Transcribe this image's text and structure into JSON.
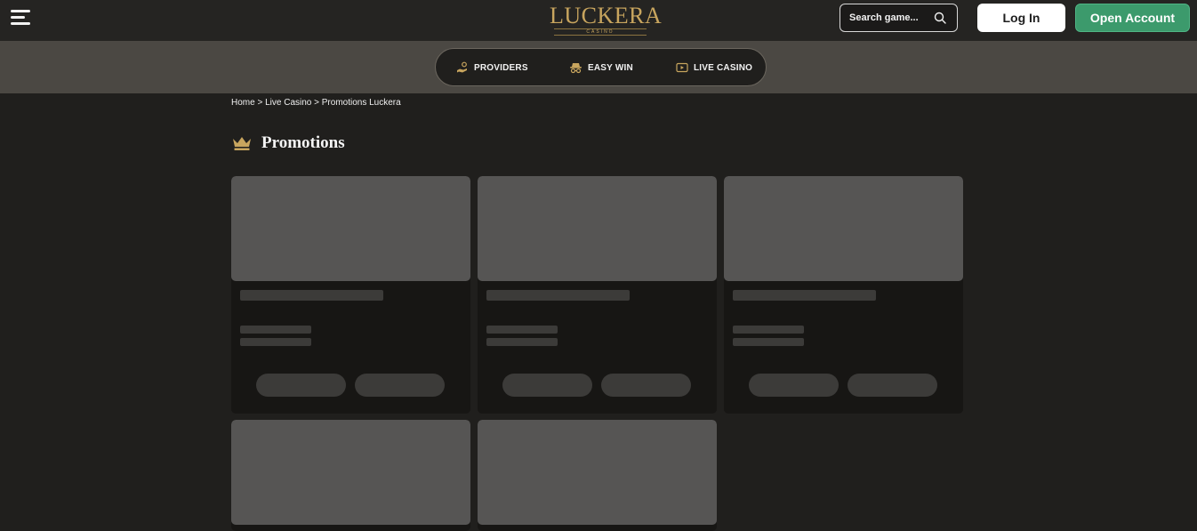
{
  "header": {
    "menu_icon": "hamburger-icon",
    "logo_text": "LUCKERA",
    "logo_subtext": "CASINO",
    "search_placeholder": "Search game...",
    "search_icon": "search-icon",
    "login_label": "Log In",
    "open_account_label": "Open Account"
  },
  "subnav": {
    "items": [
      {
        "label": "PROVIDERS",
        "icon": "hand-coins-icon"
      },
      {
        "label": "EASY WIN",
        "icon": "spy-hat-icon"
      },
      {
        "label": "LIVE CASINO",
        "icon": "play-screen-icon"
      }
    ]
  },
  "breadcrumb": {
    "items": [
      "Home",
      "Live Casino",
      "Promotions Luckera"
    ],
    "separator": ">"
  },
  "page": {
    "title": "Promotions",
    "title_icon": "crown-icon"
  },
  "colors": {
    "background": "#201f1d",
    "header": "#252422",
    "subnav": "#4b4843",
    "accent_gold": "#c8a55e",
    "open_account_green": "#3c9a6c",
    "skeleton_image": "#565554",
    "skeleton_bar": "#3c3b39"
  },
  "cards": {
    "loading": true,
    "count": 5
  }
}
